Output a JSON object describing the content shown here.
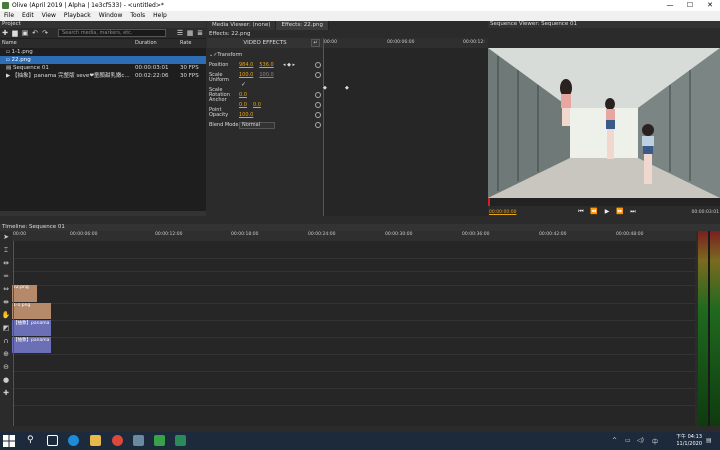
{
  "window": {
    "title": "Olive (April 2019 | Alpha | 1e3cf533) - <untitled>*"
  },
  "menu": [
    "File",
    "Edit",
    "View",
    "Playback",
    "Window",
    "Tools",
    "Help"
  ],
  "project": {
    "title": "Project",
    "search_placeholder": "Search media, markers, etc.",
    "columns": [
      "Name",
      "Duration",
      "Rate"
    ],
    "items": [
      {
        "name": "1-1.png",
        "duration": "",
        "rate": ""
      },
      {
        "name": "22.png",
        "duration": "",
        "rate": ""
      },
      {
        "name": "Sequence 01",
        "duration": "00:00:03:01",
        "rate": "30 FPS"
      },
      {
        "name": "【抽象】panama 完整版 seve❤童顏甜乳嫩c...",
        "duration": "00:02:22:06",
        "rate": "30 FPS"
      }
    ]
  },
  "effects": {
    "tabs": [
      "Media Viewer: (none)",
      "Effects: 22.png"
    ],
    "title": "Effects: 22.png",
    "header": "VIDEO EFFECTS",
    "group": "Transform",
    "ruler_start": "00:00",
    "ruler_mid": "00:00:06:00",
    "ruler_end": "00:00:12:",
    "rows": {
      "position": {
        "label": "Position",
        "x": "984.0",
        "y": "536.0"
      },
      "scale": {
        "label": "Scale",
        "a": "100.0",
        "b": "100.0"
      },
      "uniform": {
        "label": "Uniform Scale",
        "check": "✓"
      },
      "rotation": {
        "label": "Rotation",
        "v": "0.0"
      },
      "anchor": {
        "label": "Anchor Point",
        "x": "0.0",
        "y": "0.0"
      },
      "opacity": {
        "label": "Opacity",
        "v": "100.0"
      },
      "blend": {
        "label": "Blend Mode",
        "v": "Normal"
      }
    }
  },
  "viewer": {
    "title": "Sequence Viewer: Sequence 01",
    "timecode": "00:00:00:00",
    "duration": "00:00:03:01"
  },
  "timeline": {
    "title": "Timeline: Sequence 01",
    "ruler": [
      "00:00",
      "00:00:06:00",
      "00:00:12:00",
      "00:00:18:00",
      "00:00:24:00",
      "00:00:30:00",
      "00:00:36:00",
      "00:00:42:00",
      "00:00:48:00"
    ],
    "clips": {
      "v2": "22.png",
      "v1": "1-1.png",
      "a1": "【抽象】panama",
      "a2": "【抽象】panama"
    }
  },
  "taskbar": {
    "clock_time": "下午 04:13",
    "clock_date": "11/1/2020"
  }
}
